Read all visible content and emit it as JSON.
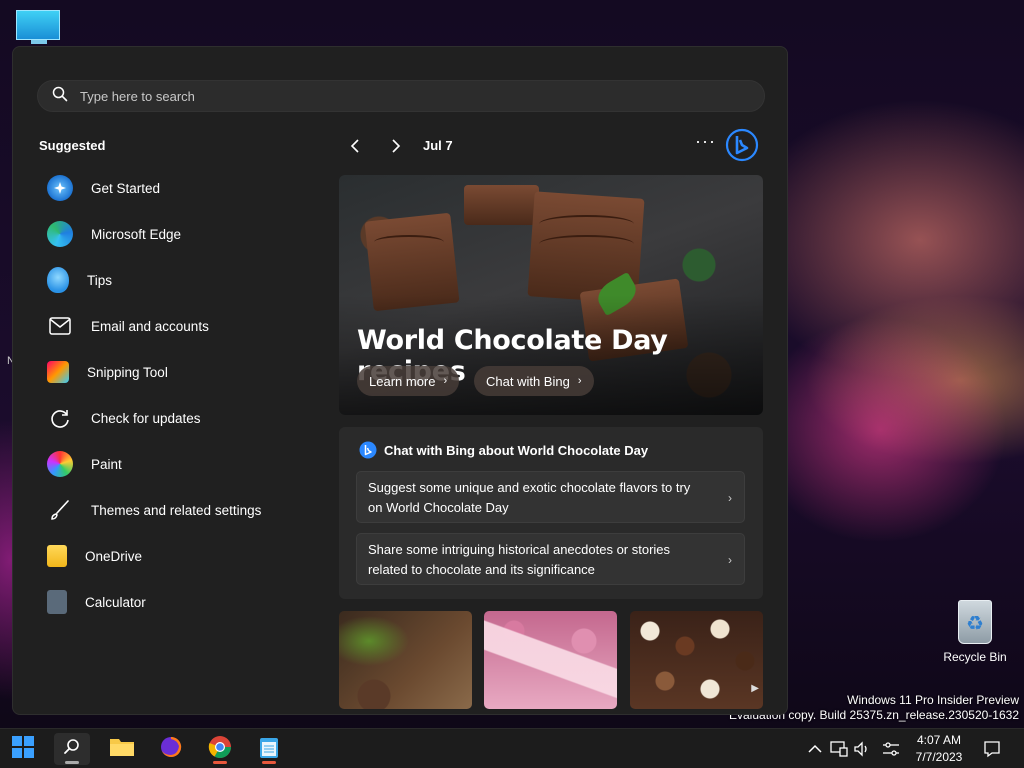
{
  "desktop": {
    "recycle_bin_label": "Recycle Bin",
    "edge_fragment": "N",
    "watermark_line1": "Windows 11 Pro Insider Preview",
    "watermark_line2": "Evaluation copy. Build 25375.zn_release.230520-1632"
  },
  "start": {
    "search_placeholder": "Type here to search",
    "suggested_title": "Suggested",
    "suggested": [
      {
        "label": "Get Started",
        "icon": "get-started-icon"
      },
      {
        "label": "Microsoft Edge",
        "icon": "edge-icon"
      },
      {
        "label": "Tips",
        "icon": "tips-icon"
      },
      {
        "label": "Email and accounts",
        "icon": "mail-icon"
      },
      {
        "label": "Snipping Tool",
        "icon": "snipping-tool-icon"
      },
      {
        "label": "Check for updates",
        "icon": "refresh-icon"
      },
      {
        "label": "Paint",
        "icon": "paint-icon"
      },
      {
        "label": "Themes and related settings",
        "icon": "brush-icon"
      },
      {
        "label": "OneDrive",
        "icon": "onedrive-icon"
      },
      {
        "label": "Calculator",
        "icon": "calculator-icon"
      }
    ],
    "date_label": "Jul 7",
    "more_label": "···",
    "hero": {
      "title": "World Chocolate Day recipes",
      "learn_more": "Learn more",
      "chat_with_bing": "Chat with Bing"
    },
    "chat": {
      "title": "Chat with Bing about World Chocolate Day",
      "prompts": [
        "Suggest some unique and exotic chocolate flavors to try on World Chocolate Day",
        "Share some intriguing historical anecdotes or stories related to chocolate and its significance"
      ]
    }
  },
  "taskbar": {
    "time": "4:07 AM",
    "date": "7/7/2023"
  },
  "colors": {
    "panel_bg": "#202020",
    "accent_blue": "#1e90ff",
    "taskbar_bg": "#1c1c1c"
  }
}
